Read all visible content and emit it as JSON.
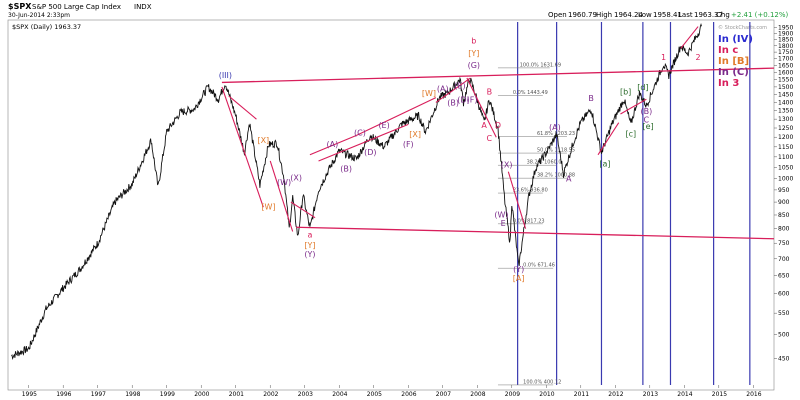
{
  "header": {
    "ticker": "$SPX",
    "name": "S&P 500 Large Cap Index",
    "exchange": "INDX",
    "date": "30-Jun-2014 2:33pm",
    "watermark": "© StockCharts.com",
    "open_lbl": "Open",
    "open": "1960.79",
    "high_lbl": "High",
    "high": "1964.24",
    "low_lbl": "Low",
    "low": "1958.41",
    "last_lbl": "Last",
    "last": "1963.37",
    "chg_lbl": "Chg",
    "chg": "+2.41 (+0.12%)"
  },
  "colors": {
    "price": "#111111",
    "fan": "#d81e5b",
    "vline": "#3a3ab0",
    "fib": "#777777",
    "up": "#1f9e3a",
    "down": "#d32020"
  },
  "chart_data": {
    "type": "line",
    "series": [
      {
        "name": "$SPX (Daily) 1963.37",
        "points": [
          [
            1994.5,
            455
          ],
          [
            1995.0,
            470
          ],
          [
            1995.5,
            560
          ],
          [
            1996.0,
            615
          ],
          [
            1996.5,
            670
          ],
          [
            1997.0,
            750
          ],
          [
            1997.5,
            900
          ],
          [
            1998.0,
            975
          ],
          [
            1998.55,
            1185
          ],
          [
            1998.75,
            960
          ],
          [
            1999.0,
            1230
          ],
          [
            1999.4,
            1340
          ],
          [
            1999.8,
            1360
          ],
          [
            2000.2,
            1500
          ],
          [
            2000.5,
            1420
          ],
          [
            2000.7,
            1525
          ],
          [
            2001.0,
            1320
          ],
          [
            2001.25,
            1120
          ],
          [
            2001.4,
            1280
          ],
          [
            2001.7,
            970
          ],
          [
            2001.95,
            1160
          ],
          [
            2002.2,
            1170
          ],
          [
            2002.4,
            1000
          ],
          [
            2002.55,
            800
          ],
          [
            2002.65,
            920
          ],
          [
            2002.8,
            770
          ],
          [
            2002.95,
            930
          ],
          [
            2003.15,
            800
          ],
          [
            2003.4,
            950
          ],
          [
            2003.7,
            1040
          ],
          [
            2004.0,
            1130
          ],
          [
            2004.5,
            1090
          ],
          [
            2004.9,
            1210
          ],
          [
            2005.3,
            1150
          ],
          [
            2005.8,
            1270
          ],
          [
            2006.3,
            1320
          ],
          [
            2006.5,
            1230
          ],
          [
            2006.9,
            1430
          ],
          [
            2007.15,
            1460
          ],
          [
            2007.5,
            1550
          ],
          [
            2007.6,
            1400
          ],
          [
            2007.78,
            1560
          ],
          [
            2007.95,
            1450
          ],
          [
            2008.2,
            1280
          ],
          [
            2008.35,
            1420
          ],
          [
            2008.6,
            1250
          ],
          [
            2008.8,
            900
          ],
          [
            2008.95,
            750
          ],
          [
            2009.0,
            900
          ],
          [
            2009.2,
            676
          ],
          [
            2009.5,
            930
          ],
          [
            2009.7,
            1050
          ],
          [
            2010.0,
            1120
          ],
          [
            2010.3,
            1215
          ],
          [
            2010.5,
            1020
          ],
          [
            2010.8,
            1180
          ],
          [
            2011.0,
            1280
          ],
          [
            2011.3,
            1360
          ],
          [
            2011.6,
            1120
          ],
          [
            2011.9,
            1270
          ],
          [
            2012.25,
            1420
          ],
          [
            2012.45,
            1270
          ],
          [
            2012.7,
            1460
          ],
          [
            2012.9,
            1380
          ],
          [
            2013.4,
            1660
          ],
          [
            2013.55,
            1580
          ],
          [
            2013.9,
            1800
          ],
          [
            2014.1,
            1740
          ],
          [
            2014.5,
            1963
          ]
        ]
      }
    ],
    "xlim": [
      1994.4,
      2016.6
    ],
    "ylim": [
      400,
      2000
    ],
    "x_ticks": [
      "1995",
      "1996",
      "1997",
      "1998",
      "1999",
      "2000",
      "2001",
      "2002",
      "2003",
      "2004",
      "2005",
      "2006",
      "2007",
      "2008",
      "2009",
      "2010",
      "2011",
      "2012",
      "2013",
      "2014",
      "2015",
      "2016"
    ],
    "y_ticks": [
      450,
      500,
      550,
      600,
      650,
      700,
      750,
      800,
      850,
      900,
      950,
      1000,
      1050,
      1100,
      1150,
      1200,
      1250,
      1300,
      1350,
      1400,
      1450,
      1500,
      1550,
      1600,
      1650,
      1700,
      1750,
      1800,
      1850,
      1900,
      1950
    ],
    "y_scale": "log",
    "grid": false,
    "vertical_lines": [
      2009.17,
      2010.3,
      2011.6,
      2012.8,
      2013.6,
      2014.85,
      2015.9
    ],
    "fan_lines": [
      {
        "from": [
          2000.6,
          1530
        ],
        "to": [
          2016.6,
          1630
        ]
      },
      {
        "from": [
          2002.75,
          805
        ],
        "to": [
          2016.6,
          765
        ]
      }
    ],
    "segments": [
      {
        "from": [
          2000.6,
          1500
        ],
        "to": [
          2001.8,
          880
        ]
      },
      {
        "from": [
          2000.8,
          1440
        ],
        "to": [
          2001.6,
          1300
        ]
      },
      {
        "from": [
          2002.0,
          1080
        ],
        "to": [
          2002.65,
          790
        ]
      },
      {
        "from": [
          2002.6,
          900
        ],
        "to": [
          2003.3,
          840
        ]
      },
      {
        "from": [
          2003.15,
          1110
        ],
        "to": [
          2004.5,
          1210
        ]
      },
      {
        "from": [
          2004.5,
          1210
        ],
        "to": [
          2006.8,
          1430
        ]
      },
      {
        "from": [
          2003.4,
          1080
        ],
        "to": [
          2006.0,
          1270
        ]
      },
      {
        "from": [
          2006.8,
          1400
        ],
        "to": [
          2007.8,
          1560
        ]
      },
      {
        "from": [
          2007.7,
          1560
        ],
        "to": [
          2008.55,
          1200
        ]
      },
      {
        "from": [
          2008.9,
          1030
        ],
        "to": [
          2009.4,
          800
        ]
      },
      {
        "from": [
          2011.5,
          1110
        ],
        "to": [
          2012.1,
          1280
        ]
      },
      {
        "from": [
          2012.15,
          1330
        ],
        "to": [
          2012.9,
          1420
        ]
      },
      {
        "from": [
          2013.9,
          1780
        ],
        "to": [
          2014.4,
          1960
        ]
      }
    ],
    "fib_levels": [
      {
        "y": 1631.69,
        "x0": 2008.6,
        "x1": 2010.1,
        "label": "100.0% 1631.69"
      },
      {
        "y": 1443.49,
        "x0": 2008.6,
        "x1": 2009.9,
        "label": "0.0% 1443.49"
      },
      {
        "y": 1203.23,
        "x0": 2008.6,
        "x1": 2010.6,
        "label": "61.8% 1203.23"
      },
      {
        "y": 1118.55,
        "x0": 2008.6,
        "x1": 2010.6,
        "label": "50.0% 1118.55"
      },
      {
        "y": 1060.0,
        "x0": 2008.6,
        "x1": 2010.3,
        "label": "38.2% 1060.0"
      },
      {
        "y": 1000.88,
        "x0": 2008.6,
        "x1": 2010.6,
        "label": "38.2% 1000.88"
      },
      {
        "y": 936.8,
        "x0": 2008.6,
        "x1": 2009.9,
        "label": "23.6% 936.80"
      },
      {
        "y": 817.23,
        "x0": 2008.6,
        "x1": 2009.9,
        "label": "0.0% 817.23"
      },
      {
        "y": 671.46,
        "x0": 2008.6,
        "x1": 2010.2,
        "label": "0.0% 671.46"
      },
      {
        "y": 400.12,
        "x0": 2008.6,
        "x1": 2010.2,
        "label": "100.0% 400.12"
      }
    ],
    "wave_labels": [
      {
        "t": "(III)",
        "x": 2000.7,
        "y": 1560,
        "c": "#3a3ab0"
      },
      {
        "t": "[X]",
        "x": 2001.8,
        "y": 1170,
        "c": "#e07a2a"
      },
      {
        "t": "[W]",
        "x": 2001.95,
        "y": 870,
        "c": "#e07a2a"
      },
      {
        "t": "(W)",
        "x": 2002.4,
        "y": 970,
        "c": "#7a2a8a"
      },
      {
        "t": "(X)",
        "x": 2002.75,
        "y": 990,
        "c": "#7a2a8a"
      },
      {
        "t": "a",
        "x": 2003.15,
        "y": 770,
        "c": "#d81e5b"
      },
      {
        "t": "[Y]",
        "x": 2003.15,
        "y": 735,
        "c": "#e07a2a"
      },
      {
        "t": "(Y)",
        "x": 2003.15,
        "y": 705,
        "c": "#7a2a8a"
      },
      {
        "t": "(A)",
        "x": 2003.8,
        "y": 1150,
        "c": "#7a2a8a"
      },
      {
        "t": "(B)",
        "x": 2004.2,
        "y": 1030,
        "c": "#7a2a8a"
      },
      {
        "t": "(C)",
        "x": 2004.6,
        "y": 1210,
        "c": "#7a2a8a"
      },
      {
        "t": "(D)",
        "x": 2004.9,
        "y": 1110,
        "c": "#7a2a8a"
      },
      {
        "t": "(E)",
        "x": 2005.3,
        "y": 1250,
        "c": "#7a2a8a"
      },
      {
        "t": "(F)",
        "x": 2006.0,
        "y": 1150,
        "c": "#7a2a8a"
      },
      {
        "t": "[X]",
        "x": 2006.2,
        "y": 1200,
        "c": "#e07a2a"
      },
      {
        "t": "[W]",
        "x": 2006.6,
        "y": 1440,
        "c": "#e07a2a"
      },
      {
        "t": "(A)",
        "x": 2007.0,
        "y": 1470,
        "c": "#7a2a8a"
      },
      {
        "t": "(B)",
        "x": 2007.3,
        "y": 1380,
        "c": "#7a2a8a"
      },
      {
        "t": "(D)",
        "x": 2007.6,
        "y": 1400,
        "c": "#7a2a8a"
      },
      {
        "t": "(F)",
        "x": 2007.85,
        "y": 1400,
        "c": "#7a2a8a"
      },
      {
        "t": "(E)",
        "x": 2007.5,
        "y": 1490,
        "c": "#7a2a8a"
      },
      {
        "t": "b",
        "x": 2007.9,
        "y": 1820,
        "c": "#d81e5b"
      },
      {
        "t": "[Y]",
        "x": 2007.9,
        "y": 1720,
        "c": "#e07a2a"
      },
      {
        "t": "(G)",
        "x": 2007.9,
        "y": 1630,
        "c": "#7a2a8a"
      },
      {
        "t": "B",
        "x": 2008.35,
        "y": 1450,
        "c": "#d81e5b"
      },
      {
        "t": "A",
        "x": 2008.2,
        "y": 1250,
        "c": "#d81e5b"
      },
      {
        "t": "C",
        "x": 2008.35,
        "y": 1180,
        "c": "#d81e5b"
      },
      {
        "t": "D",
        "x": 2008.6,
        "y": 1250,
        "c": "#d81e5b"
      },
      {
        "t": "(X)",
        "x": 2008.85,
        "y": 1050,
        "c": "#7a2a8a"
      },
      {
        "t": "(W)",
        "x": 2008.7,
        "y": 840,
        "c": "#7a2a8a"
      },
      {
        "t": "E",
        "x": 2008.75,
        "y": 810,
        "c": "#7a2a8a"
      },
      {
        "t": "(Y)",
        "x": 2009.2,
        "y": 660,
        "c": "#7a2a8a"
      },
      {
        "t": "[A]",
        "x": 2009.2,
        "y": 635,
        "c": "#e07a2a"
      },
      {
        "t": "(A)",
        "x": 2010.25,
        "y": 1240,
        "c": "#7a2a8a"
      },
      {
        "t": "B",
        "x": 2011.3,
        "y": 1410,
        "c": "#7a2a8a"
      },
      {
        "t": "A",
        "x": 2010.65,
        "y": 985,
        "c": "#7a2a8a"
      },
      {
        "t": "[a]",
        "x": 2011.7,
        "y": 1055,
        "c": "#2a6b2a"
      },
      {
        "t": "[b]",
        "x": 2012.3,
        "y": 1450,
        "c": "#2a6b2a"
      },
      {
        "t": "[c]",
        "x": 2012.45,
        "y": 1205,
        "c": "#2a6b2a"
      },
      {
        "t": "[d]",
        "x": 2012.8,
        "y": 1480,
        "c": "#2a6b2a"
      },
      {
        "t": "[e]",
        "x": 2012.95,
        "y": 1245,
        "c": "#2a6b2a"
      },
      {
        "t": "(B)",
        "x": 2012.9,
        "y": 1330,
        "c": "#7a2a8a"
      },
      {
        "t": "C",
        "x": 2012.9,
        "y": 1280,
        "c": "#7a2a8a"
      },
      {
        "t": "1",
        "x": 2013.4,
        "y": 1690,
        "c": "#d81e5b"
      },
      {
        "t": "2",
        "x": 2014.4,
        "y": 1690,
        "c": "#d81e5b"
      }
    ],
    "legend": [
      {
        "t": "In (IV)",
        "c": "#2a2ad0"
      },
      {
        "t": "In c",
        "c": "#d81e5b"
      },
      {
        "t": "In [B]",
        "c": "#e07a2a"
      },
      {
        "t": "In (C)",
        "c": "#7a2a8a"
      },
      {
        "t": "In 3",
        "c": "#d81e5b"
      }
    ]
  }
}
